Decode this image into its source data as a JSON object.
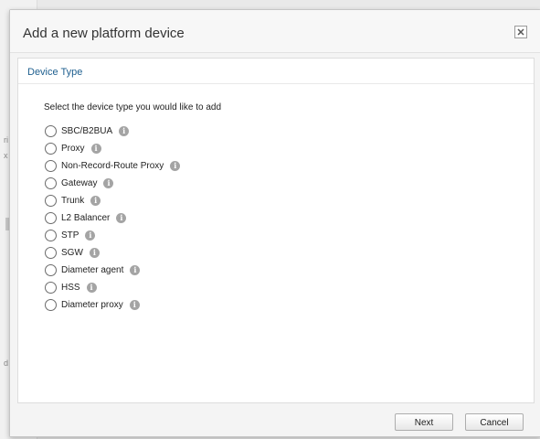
{
  "background": {
    "fragments": [
      "ri",
      "x",
      "d"
    ]
  },
  "dialog": {
    "title": "Add a new platform device",
    "close_icon": "close-icon",
    "section_title": "Device Type",
    "instruction": "Select the device type you would like to add",
    "options": [
      {
        "label": "SBC/B2BUA",
        "selected": false,
        "info_icon": "info-icon"
      },
      {
        "label": "Proxy",
        "selected": false,
        "info_icon": "info-icon"
      },
      {
        "label": "Non-Record-Route Proxy",
        "selected": false,
        "info_icon": "info-icon"
      },
      {
        "label": "Gateway",
        "selected": false,
        "info_icon": "info-icon"
      },
      {
        "label": "Trunk",
        "selected": false,
        "info_icon": "info-icon"
      },
      {
        "label": "L2 Balancer",
        "selected": false,
        "info_icon": "info-icon"
      },
      {
        "label": "STP",
        "selected": false,
        "info_icon": "info-icon"
      },
      {
        "label": "SGW",
        "selected": false,
        "info_icon": "info-icon"
      },
      {
        "label": "Diameter agent",
        "selected": false,
        "info_icon": "info-icon"
      },
      {
        "label": "HSS",
        "selected": false,
        "info_icon": "info-icon"
      },
      {
        "label": "Diameter proxy",
        "selected": false,
        "info_icon": "info-icon"
      }
    ],
    "buttons": {
      "next": "Next",
      "cancel": "Cancel"
    }
  },
  "colors": {
    "section_title": "#1e5f8f",
    "info_icon": "#a4a4a4"
  }
}
